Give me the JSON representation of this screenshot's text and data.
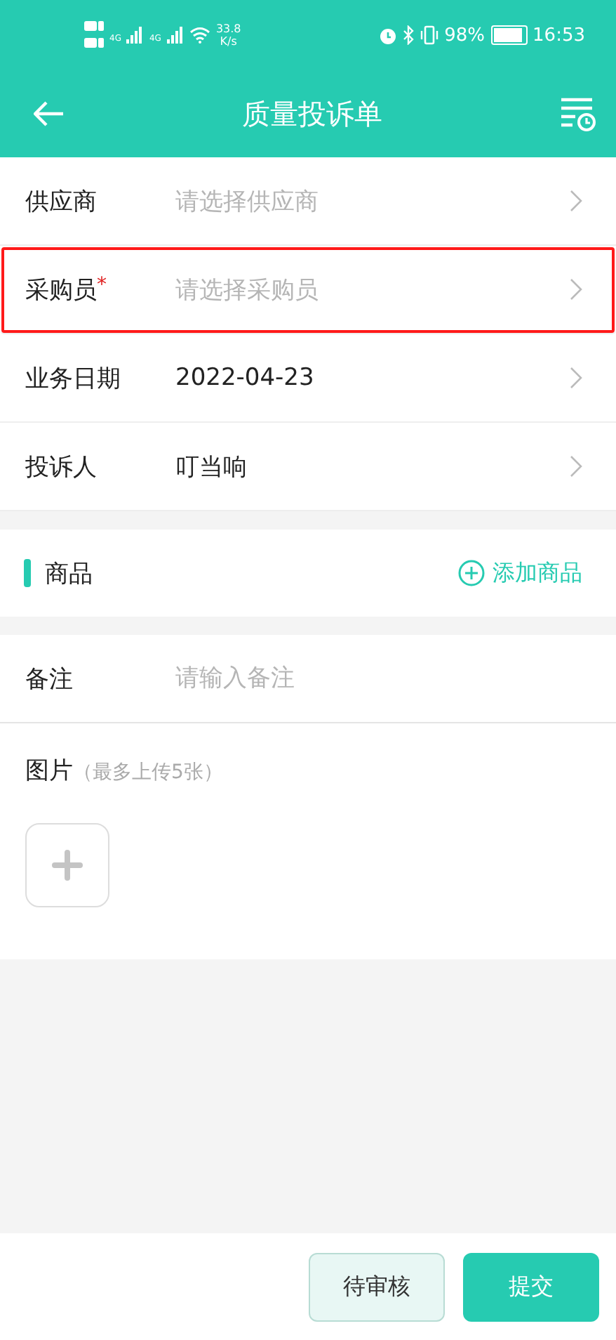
{
  "status_bar": {
    "network": [
      "4G",
      "4G"
    ],
    "speed": "33.8",
    "speed_unit": "K/s",
    "battery": "98%",
    "time": "16:53"
  },
  "nav": {
    "title": "质量投诉单"
  },
  "fields": [
    {
      "label": "供应商",
      "highlighted": false,
      "placeholder": "请选择供应商"
    },
    {
      "label": "采购员",
      "required_mark": "*",
      "highlighted": true,
      "placeholder": "请选择采购员"
    },
    {
      "label": "业务日期",
      "highlighted": false,
      "value": "2022-04-23"
    },
    {
      "label": "投诉人",
      "highlighted": false,
      "value": "叮当响"
    }
  ],
  "goods": {
    "title": "商品",
    "add": "添加商品"
  },
  "remark": {
    "label": "备注",
    "placeholder": "请输入备注"
  },
  "pictures": {
    "label": "图片",
    "hint": "（最多上传5张）"
  },
  "buttons": [
    {
      "label": "待审核",
      "kind": "secondary"
    },
    {
      "label": "提交",
      "kind": "primary"
    }
  ]
}
